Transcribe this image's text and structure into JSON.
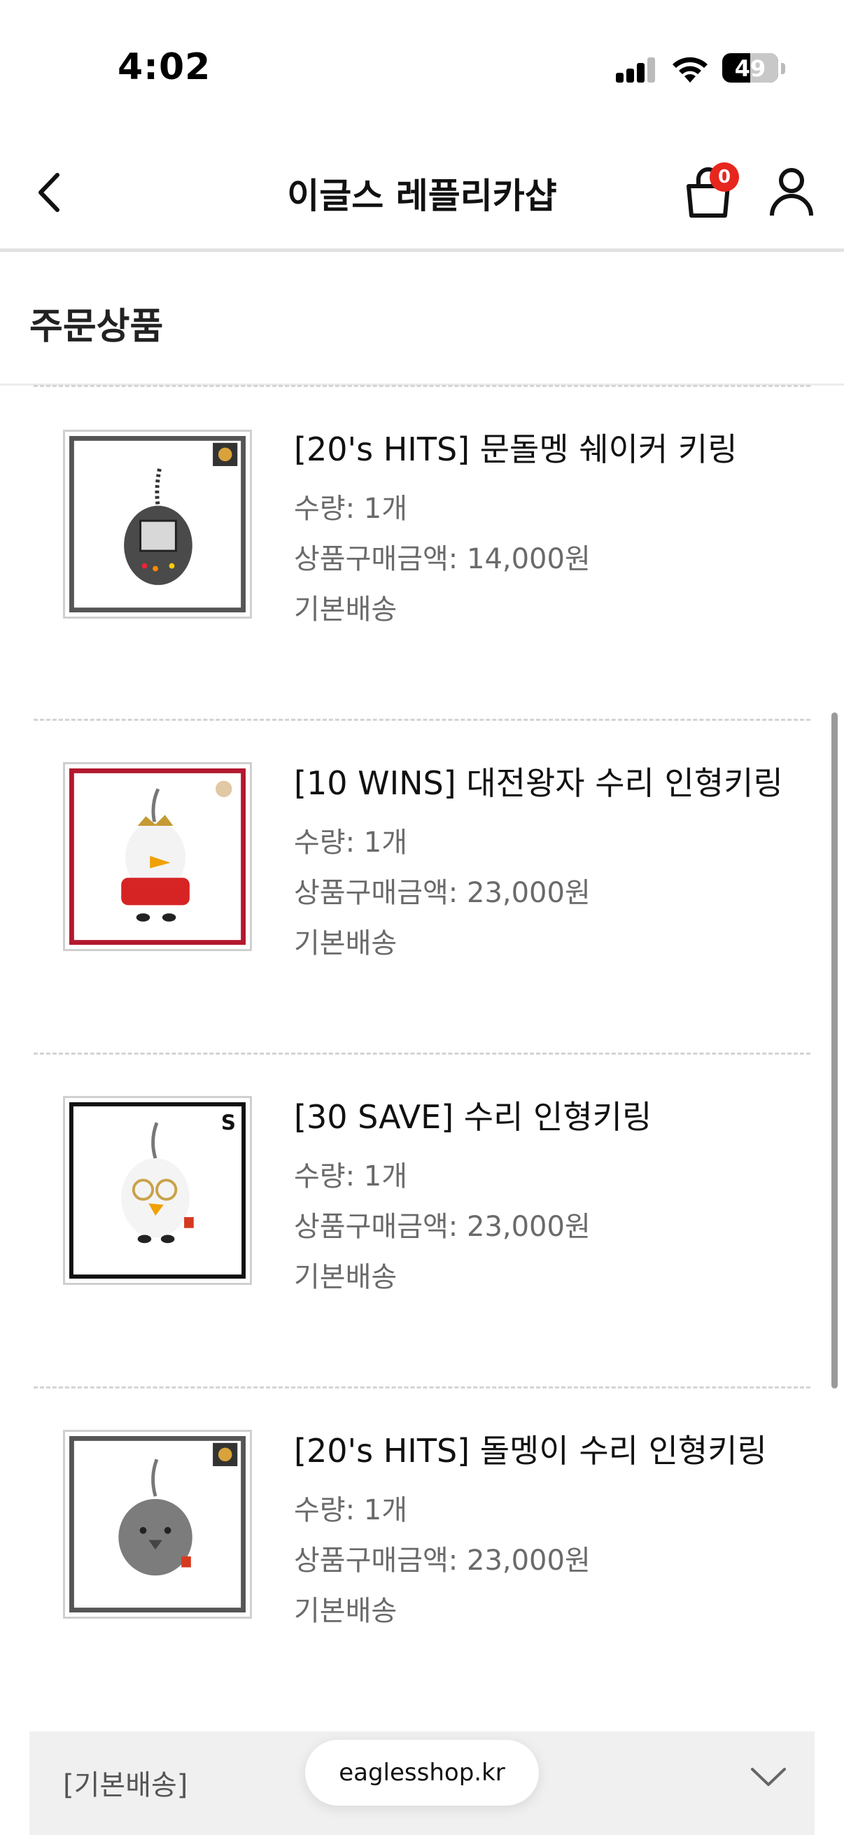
{
  "status": {
    "time": "4:02",
    "battery": "49"
  },
  "header": {
    "title": "이글스 레플리카샵",
    "cart_count": "0"
  },
  "section": {
    "title": "주문상품"
  },
  "items": [
    {
      "name": "[20's HITS] 문돌멩 쉐이커 키링",
      "qty": "수량: 1개",
      "price": "상품구매금액: 14,000원",
      "shipping": "기본배송"
    },
    {
      "name": "[10 WINS] 대전왕자 수리 인형키링",
      "qty": "수량: 1개",
      "price": "상품구매금액: 23,000원",
      "shipping": "기본배송"
    },
    {
      "name": "[30 SAVE] 수리 인형키링",
      "qty": "수량: 1개",
      "price": "상품구매금액: 23,000원",
      "shipping": "기본배송"
    },
    {
      "name": "[20's HITS] 돌멩이 수리 인형키링",
      "qty": "수량: 1개",
      "price": "상품구매금액: 23,000원",
      "shipping": "기본배송"
    }
  ],
  "shipping_bar": {
    "label": "[기본배송]"
  },
  "browser": {
    "url": "eaglesshop.kr"
  },
  "colors": {
    "badge": "#e7261d",
    "text_secondary": "#6a6a6a"
  }
}
